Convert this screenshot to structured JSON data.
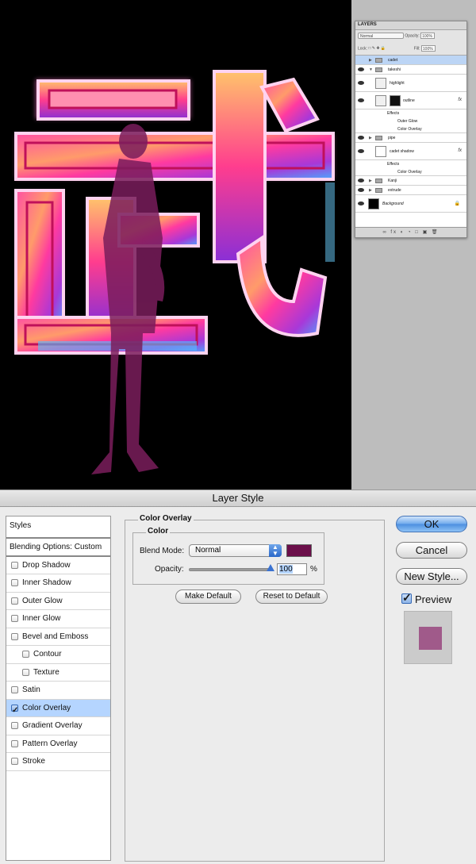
{
  "layers_panel": {
    "tab": "LAYERS",
    "blend_mode": "Normal",
    "opacity_label": "Opacity:",
    "opacity_value": "100%",
    "lock_label": "Lock:",
    "fill_label": "Fill:",
    "fill_value": "100%",
    "layers": [
      {
        "name": "cadet",
        "type": "group",
        "selected": true
      },
      {
        "name": "takeshi",
        "type": "group"
      },
      {
        "name": "highlight",
        "type": "layer"
      },
      {
        "name": "outline",
        "type": "layer",
        "fx": "fx"
      },
      {
        "name": "Effects",
        "type": "effects"
      },
      {
        "name": "Outer Glow",
        "type": "effect"
      },
      {
        "name": "Color Overlay",
        "type": "effect"
      },
      {
        "name": "pipe",
        "type": "group"
      },
      {
        "name": "cadet shadow",
        "type": "layer",
        "fx": "fx"
      },
      {
        "name": "Effects",
        "type": "effects"
      },
      {
        "name": "Color Overlay",
        "type": "effect"
      },
      {
        "name": "Kanji",
        "type": "group"
      },
      {
        "name": "extrude",
        "type": "group"
      },
      {
        "name": "Background",
        "type": "background"
      }
    ]
  },
  "canvas": {
    "glyph": "武",
    "shadow_color": "#7a1d5c"
  },
  "dialog": {
    "title": "Layer Style",
    "styles_header": "Styles",
    "blending_options": "Blending Options: Custom",
    "style_items": [
      {
        "label": "Drop Shadow",
        "checked": false,
        "indent": false
      },
      {
        "label": "Inner Shadow",
        "checked": false,
        "indent": false
      },
      {
        "label": "Outer Glow",
        "checked": false,
        "indent": false
      },
      {
        "label": "Inner Glow",
        "checked": false,
        "indent": false
      },
      {
        "label": "Bevel and Emboss",
        "checked": false,
        "indent": false
      },
      {
        "label": "Contour",
        "checked": false,
        "indent": true
      },
      {
        "label": "Texture",
        "checked": false,
        "indent": true
      },
      {
        "label": "Satin",
        "checked": false,
        "indent": false
      },
      {
        "label": "Color Overlay",
        "checked": true,
        "indent": false,
        "active": true
      },
      {
        "label": "Gradient Overlay",
        "checked": false,
        "indent": false
      },
      {
        "label": "Pattern Overlay",
        "checked": false,
        "indent": false
      },
      {
        "label": "Stroke",
        "checked": false,
        "indent": false
      }
    ],
    "section_title": "Color Overlay",
    "color_group_title": "Color",
    "blend_mode_label": "Blend Mode:",
    "blend_mode_value": "Normal",
    "overlay_color": "#6b0f4a",
    "opacity_label": "Opacity:",
    "opacity_value": "100",
    "opacity_fraction": 1.0,
    "opacity_unit": "%",
    "make_default": "Make Default",
    "reset_default": "Reset to Default",
    "ok": "OK",
    "cancel": "Cancel",
    "new_style": "New Style...",
    "preview_label": "Preview",
    "preview_checked": true,
    "preview_color": "#a05a8a"
  }
}
